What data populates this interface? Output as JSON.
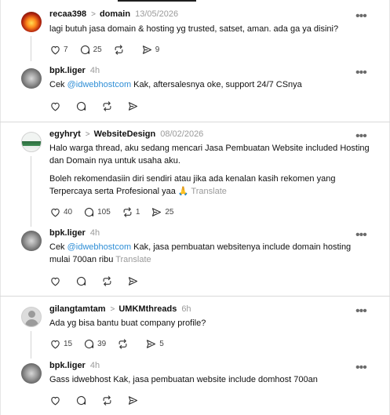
{
  "threads": [
    {
      "post": {
        "user": "recaa398",
        "topic": "domain",
        "date": "13/05/2026",
        "text": "lagi butuh jasa domain & hosting yg trusted, satset, aman. ada ga ya disini?",
        "likes": "7",
        "comments": "25",
        "reposts": "",
        "shares": "9"
      },
      "reply": {
        "user": "bpk.liger",
        "date": "4h",
        "pre": "Cek ",
        "mention": "@idwebhostcom",
        "post": " Kak, aftersalesnya oke, support 24/7 CSnya"
      }
    },
    {
      "post": {
        "user": "egyhryt",
        "topic": "WebsiteDesign",
        "date": "08/02/2026",
        "text1": "Halo warga thread, aku sedang mencari Jasa Pembuatan Website included Hosting dan Domain nya untuk usaha aku.",
        "text2": "Boleh rekomendasiin diri sendiri atau jika ada kenalan kasih rekomen yang Terpercaya serta Profesional yaa 🙏",
        "translate": "Translate",
        "likes": "40",
        "comments": "105",
        "reposts": "1",
        "shares": "25"
      },
      "reply": {
        "user": "bpk.liger",
        "date": "4h",
        "pre": "Cek ",
        "mention": "@idwebhostcom",
        "post": " Kak, jasa pembuatan websitenya include domain hosting mulai 700an ribu",
        "translate": "Translate"
      }
    },
    {
      "post": {
        "user": "gilangtamtam",
        "topic": "UMKMthreads",
        "date": "6h",
        "text": "Ada yg bisa bantu buat company profile?",
        "likes": "15",
        "comments": "39",
        "reposts": "",
        "shares": "5"
      },
      "reply": {
        "user": "bpk.liger",
        "date": "4h",
        "text": "Gass idwebhost Kak, jasa pembuatan website include domhost 700an"
      }
    }
  ],
  "icons": {
    "more": "more-horizontal-icon",
    "like": "heart-icon",
    "comment": "comment-bubble-icon",
    "repost": "repost-arrows-icon",
    "share": "send-icon"
  },
  "colors": {
    "mention": "#2e8ed6",
    "muted": "#9a9a9a",
    "divider": "#d9d9d9"
  }
}
